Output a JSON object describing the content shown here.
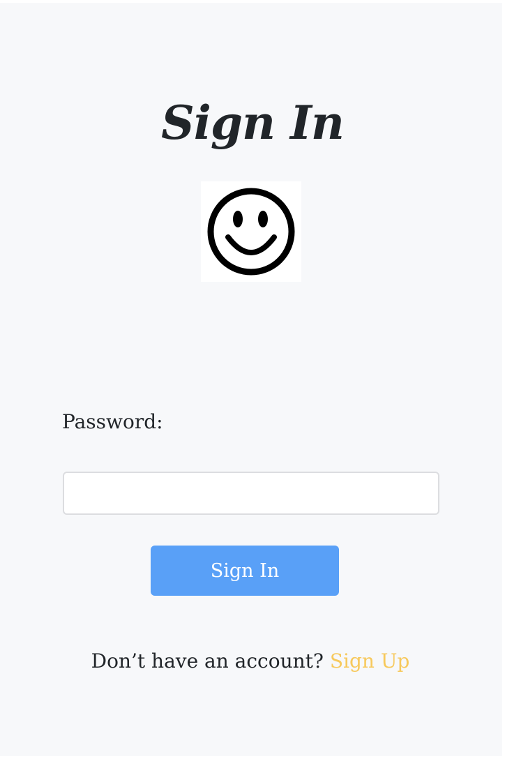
{
  "header": {
    "title": "Sign In"
  },
  "avatar": {
    "icon": "smiley-face-icon"
  },
  "form": {
    "password_label": "Password:",
    "password_value": "",
    "submit_label": "Sign In"
  },
  "footer": {
    "prompt": "Don’t have an account?",
    "signup_label": "Sign Up"
  },
  "colors": {
    "background": "#f7f8fa",
    "primary_button": "#59a0f7",
    "link": "#f7c95c",
    "text": "#212529"
  }
}
